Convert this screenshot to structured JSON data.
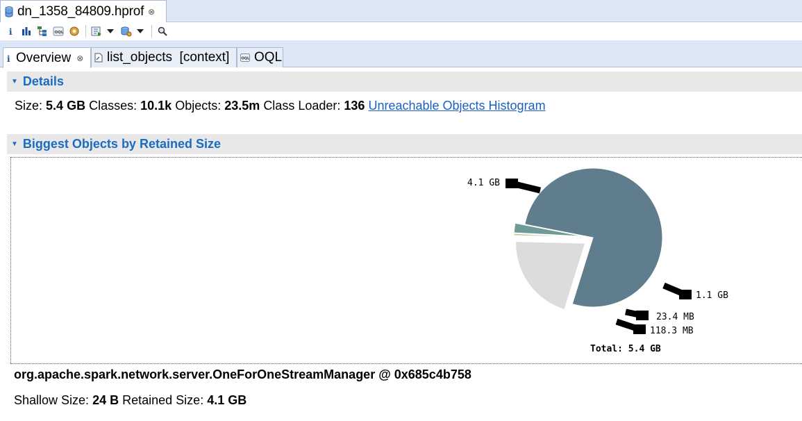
{
  "editor_tab": {
    "title": "dn_1358_84809.hprof",
    "close_glyph": "⊗"
  },
  "toolbar": {
    "icons": [
      "info-icon",
      "histogram-icon",
      "dominator-tree-icon",
      "oql-icon",
      "thread-overview-icon",
      "run-report-icon",
      "query-browser-icon",
      "search-icon"
    ]
  },
  "tabs": [
    {
      "label": "Overview",
      "icon": "info-icon",
      "close": "⊗"
    },
    {
      "label": "list_objects  [context]",
      "icon": "list-icon"
    },
    {
      "label": "OQL",
      "icon": "oql-icon"
    }
  ],
  "details": {
    "heading": "Details",
    "size_label": "Size:",
    "size_value": "5.4 GB",
    "classes_label": "Classes:",
    "classes_value": "10.1k",
    "objects_label": "Objects:",
    "objects_value": "23.5m",
    "classloader_label": "Class Loader:",
    "classloader_value": "136",
    "histogram_link": "Unreachable Objects Histogram"
  },
  "biggest": {
    "heading": "Biggest Objects by Retained Size"
  },
  "chart_data": {
    "type": "pie",
    "unit": "GB",
    "slices": [
      {
        "label": "4.1 GB",
        "value": 4.1,
        "color": "#5f7d8c"
      },
      {
        "label": "1.1 GB",
        "value": 1.1,
        "color": "#dcdcdc"
      },
      {
        "label": "23.4 MB",
        "value": 0.0234,
        "color": "#c4c39a"
      },
      {
        "label": "118.3 MB",
        "value": 0.1183,
        "color": "#6f9a97"
      }
    ],
    "total_label": "Total: 5.4 GB"
  },
  "selected_object": {
    "name": "org.apache.spark.network.server.OneForOneStreamManager @ 0x685c4b758",
    "shallow_label": "Shallow Size:",
    "shallow_value": "24 B",
    "retained_label": "Retained Size:",
    "retained_value": "4.1 GB"
  }
}
